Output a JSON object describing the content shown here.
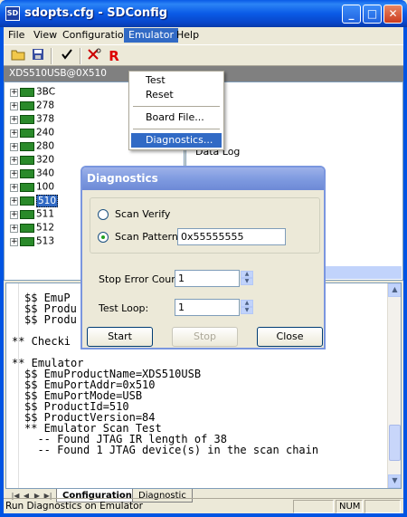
{
  "window": {
    "title": "sdopts.cfg - SDConfig",
    "app_icon": "SD",
    "minimize": "_",
    "maximize": "□",
    "close": "✕"
  },
  "menubar": {
    "items": [
      "File",
      "View",
      "Configuration",
      "Emulator",
      "Help"
    ],
    "active": "Emulator"
  },
  "toolbar": {
    "icons": [
      "open-folder-icon",
      "save-icon",
      "check-icon",
      "cut-icon",
      "reset-r-icon"
    ]
  },
  "emulator_menu": {
    "items": [
      "Test",
      "Reset",
      "Board File...",
      "Diagnostics..."
    ],
    "highlighted": "Diagnostics..."
  },
  "device_bar": {
    "label": "XDS510USB@0X510"
  },
  "tree": {
    "items": [
      "3BC",
      "278",
      "378",
      "240",
      "280",
      "320",
      "340",
      "100",
      "510",
      "511",
      "512",
      "513"
    ],
    "selected": "510"
  },
  "right_pane": {
    "label": "Data Log"
  },
  "output": {
    "lines": [
      "$$ EmuP",
      "$$ Produ",
      "$$ Produ",
      "",
      "** Checki",
      "",
      "** Emulator",
      "$$ EmuProductName=XDS510USB",
      "$$ EmuPortAddr=0x510",
      "$$ EmuPortMode=USB",
      "$$ ProductId=510",
      "$$ ProductVersion=84",
      "** Emulator Scan Test",
      "  -- Found JTAG IR length of 38",
      "  -- Found 1 JTAG device(s) in the scan chain"
    ]
  },
  "tabs": {
    "items": [
      "Configuration",
      "Diagnostic"
    ],
    "active": "Configuration"
  },
  "statusbar": {
    "message": "Run Diagnostics on Emulator",
    "num": "NUM"
  },
  "dialog": {
    "title": "Diagnostics",
    "scan_verify_label": "Scan Verify",
    "scan_pattern_label": "Scan Pattern",
    "scan_pattern_value": "0x55555555",
    "selected_mode": "Scan Pattern",
    "stop_error_label": "Stop Error Count:",
    "stop_error_value": "1",
    "test_loop_label": "Test Loop:",
    "test_loop_value": "1",
    "start_label": "Start",
    "stop_label": "Stop",
    "close_label": "Close"
  }
}
